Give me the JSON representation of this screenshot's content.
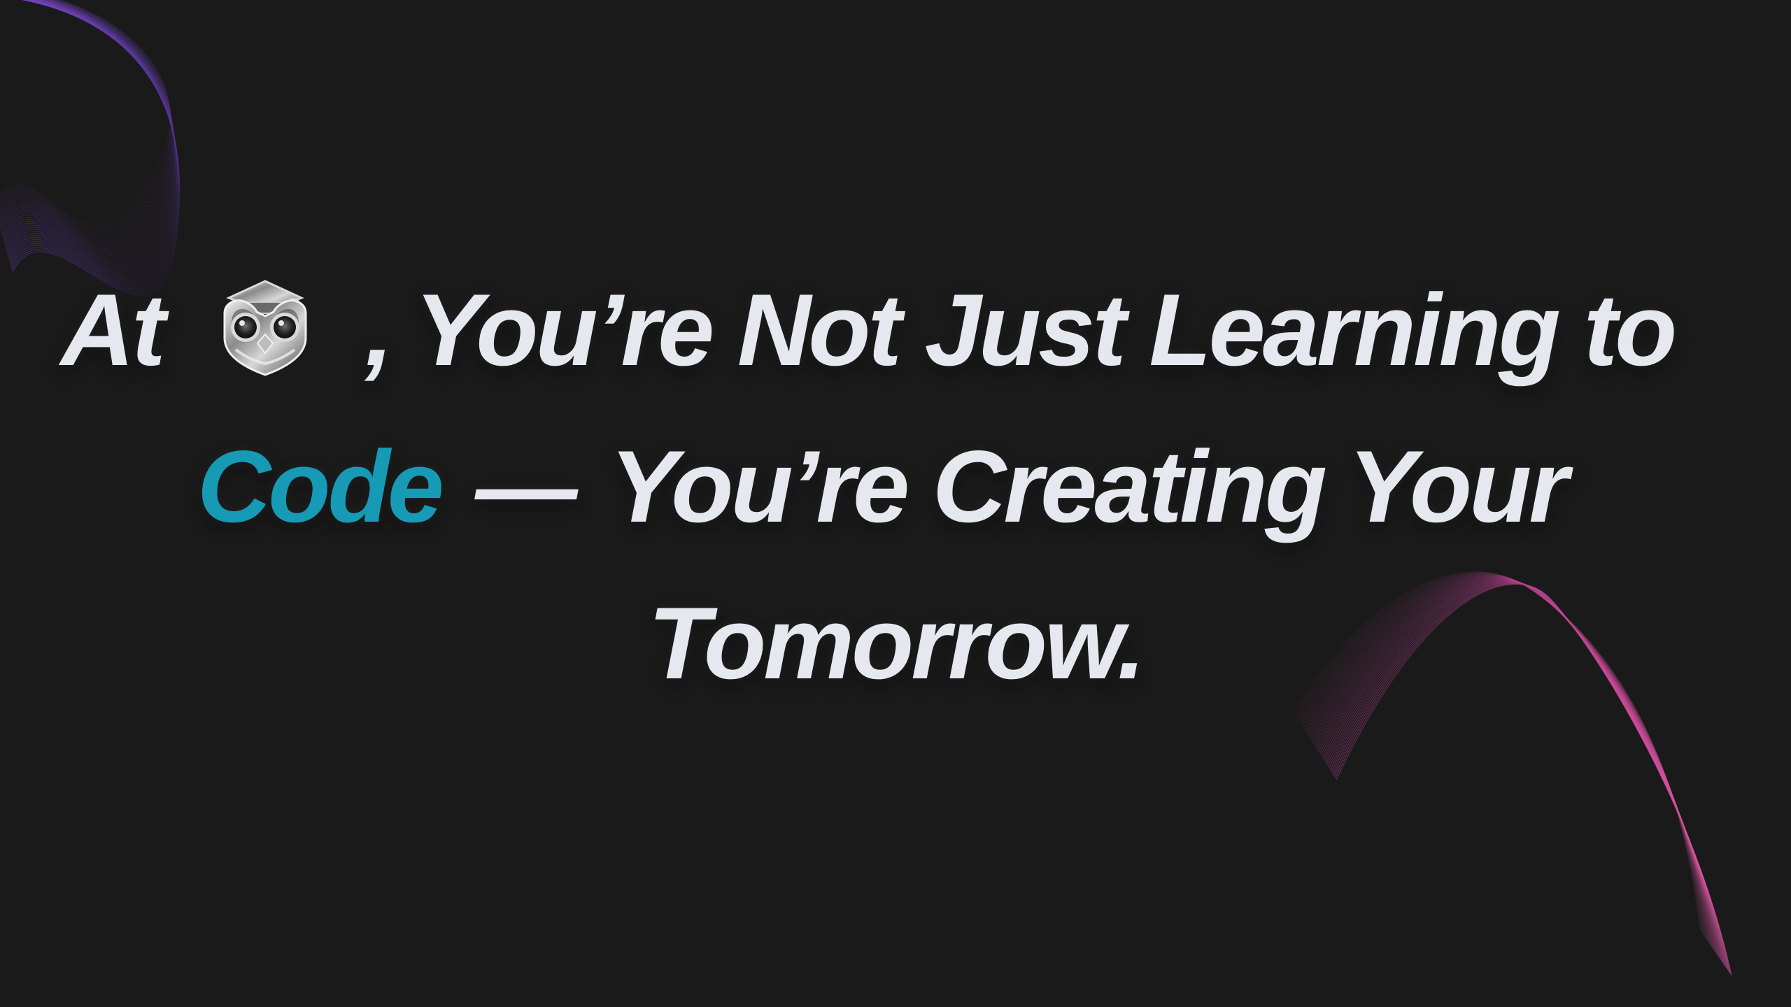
{
  "headline": {
    "line1_prefix": "At",
    "line1_suffix": ", You’re Not Just Learning to",
    "line2_accent": "Code",
    "line2_dash": "—",
    "line2_suffix": "You’re Creating Your",
    "line3": "Tomorrow."
  },
  "logo": {
    "icon_name": "owl-graduation-icon"
  },
  "colors": {
    "background": "#1a1a1a",
    "text": "#e5e8ee",
    "accent": "#179ab5",
    "wave_top_left": "#7c45c8",
    "wave_bottom_right": "#d04b9c"
  }
}
